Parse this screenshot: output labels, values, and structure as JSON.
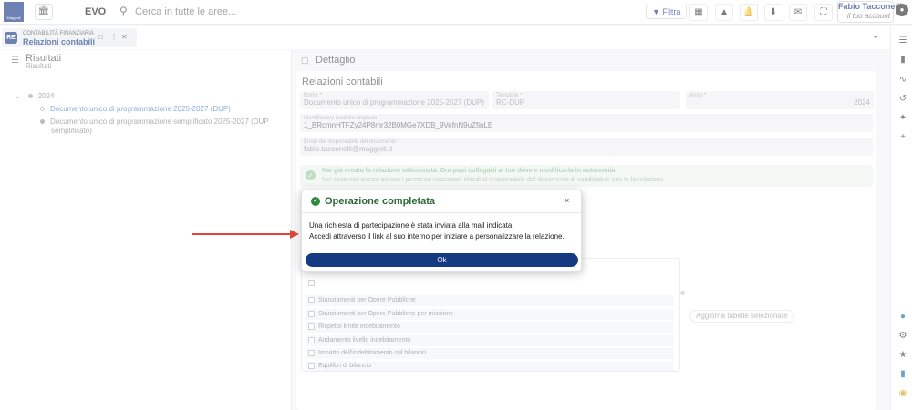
{
  "topbar": {
    "logo_text": "Maggioli",
    "bank_icon": "bank-icon",
    "app_name": "EVO",
    "search_placeholder": "Cerca in tutte le aree...",
    "filter_label": "Filtra",
    "user_name": "Fabio Tacconelli",
    "user_subtitle": "il tuo account"
  },
  "tab": {
    "badge": "RE",
    "module": "CONTABILITÀ FINANZIARIA",
    "title": "Relazioni contabili"
  },
  "left_panel": {
    "title": "Risultati",
    "subtitle": "Risultati",
    "tree": {
      "year": "2024",
      "items": [
        "Documento unico di programmazione 2025-2027 (DUP)",
        "Documento unico di programmazione semplificato 2025-2027 (DUP",
        "semplificato)"
      ]
    }
  },
  "detail": {
    "header": "Dettaglio",
    "card_title": "Relazioni contabili",
    "fields": {
      "nome_label": "Nome *",
      "nome_value": "Documento unico di programmazione 2025-2027 (DUP)",
      "template_label": "Template *",
      "template_value": "RC-DUP",
      "anno_label": "Anno *",
      "anno_value": "2024",
      "id_label": "Identificativo modello originale",
      "id_value": "1_BRcmnHTFZy24P8mr32B0MGe7XDB_9VefnN9uZfinLE",
      "email_label": "Email del responsabile del documento *",
      "email_value": "fabio.tacconelli@maggioli.it"
    },
    "info": {
      "line1": "Hai già creato la relazione selezionata. Ora puoi collegarti al tuo drive e modificarla in autonomia",
      "line2": "Nel caso non avessi ancora i permessi necessari, chiedi al responsabile del documento di condividere con te la relazione"
    },
    "table_rows": [
      "Stanziamenti per Opere Pubbliche",
      "Stanziamenti per Opere Pubbliche per missione",
      "Rispetto limite indebitamento",
      "Andamento livello indebitamento",
      "Impatto dell'indebitamento sul bilancio",
      "Equilibri di bilancio"
    ],
    "update_button": "Aggiorna tabelle selezionate"
  },
  "modal": {
    "title": "Operazione completata",
    "close": "×",
    "line1": "Una richiesta di partecipazione è stata inviata alla mail indicata.",
    "line2": "Accedi attraverso il link al suo interno per iniziare a personalizzare la relazione.",
    "ok_label": "Ok"
  },
  "colors": {
    "brand": "#1f3f8a",
    "success": "#2e8b3e",
    "arrow": "#e0453a",
    "ok_button": "#143a82"
  }
}
